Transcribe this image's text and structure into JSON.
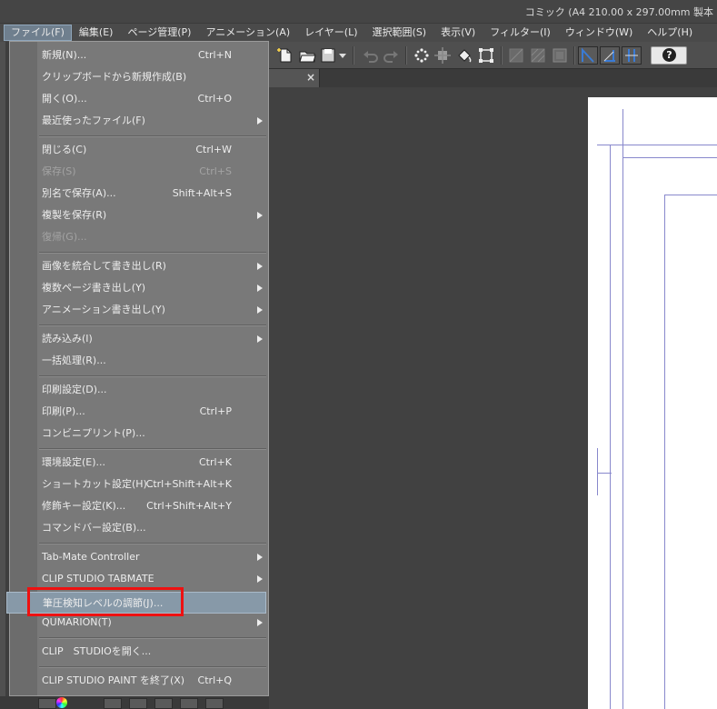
{
  "window": {
    "title": "コミック (A4 210.00 x 297.00mm 製本"
  },
  "menubar": {
    "items": [
      {
        "label": "ファイル(F)",
        "active": true
      },
      {
        "label": "編集(E)"
      },
      {
        "label": "ページ管理(P)"
      },
      {
        "label": "アニメーション(A)"
      },
      {
        "label": "レイヤー(L)"
      },
      {
        "label": "選択範囲(S)"
      },
      {
        "label": "表示(V)"
      },
      {
        "label": "フィルター(I)"
      },
      {
        "label": "ウィンドウ(W)"
      },
      {
        "label": "ヘルプ(H)"
      }
    ]
  },
  "toolbar": {
    "help_label": "?"
  },
  "tab": {
    "close_glyph": "×"
  },
  "file_menu": {
    "items": [
      {
        "label": "新規(N)...",
        "shortcut": "Ctrl+N"
      },
      {
        "label": "クリップボードから新規作成(B)"
      },
      {
        "label": "開く(O)...",
        "shortcut": "Ctrl+O"
      },
      {
        "label": "最近使ったファイル(F)",
        "submenu": true
      },
      {
        "label": "閉じる(C)",
        "shortcut": "Ctrl+W"
      },
      {
        "label": "保存(S)",
        "shortcut": "Ctrl+S",
        "disabled": true
      },
      {
        "label": "別名で保存(A)...",
        "shortcut": "Shift+Alt+S"
      },
      {
        "label": "複製を保存(R)",
        "submenu": true
      },
      {
        "label": "復帰(G)...",
        "disabled": true
      },
      {
        "label": "画像を統合して書き出し(R)",
        "submenu": true
      },
      {
        "label": "複数ページ書き出し(Y)",
        "submenu": true
      },
      {
        "label": "アニメーション書き出し(Y)",
        "submenu": true
      },
      {
        "label": "読み込み(I)",
        "submenu": true
      },
      {
        "label": "一括処理(R)..."
      },
      {
        "label": "印刷設定(D)..."
      },
      {
        "label": "印刷(P)...",
        "shortcut": "Ctrl+P"
      },
      {
        "label": "コンビニプリント(P)..."
      },
      {
        "label": "環境設定(E)...",
        "shortcut": "Ctrl+K"
      },
      {
        "label": "ショートカット設定(H)...",
        "shortcut": "Ctrl+Shift+Alt+K"
      },
      {
        "label": "修飾キー設定(K)...",
        "shortcut": "Ctrl+Shift+Alt+Y"
      },
      {
        "label": "コマンドバー設定(B)..."
      },
      {
        "label": "Tab-Mate Controller",
        "submenu": true
      },
      {
        "label": "CLIP STUDIO TABMATE",
        "submenu": true
      },
      {
        "label": "筆圧検知レベルの調節(J)...",
        "highlighted": true
      },
      {
        "label": "QUMARION(T)",
        "submenu": true
      },
      {
        "label": "CLIP　STUDIOを開く..."
      },
      {
        "label": "CLIP STUDIO PAINT を終了(X)",
        "shortcut": "Ctrl+Q"
      }
    ]
  }
}
